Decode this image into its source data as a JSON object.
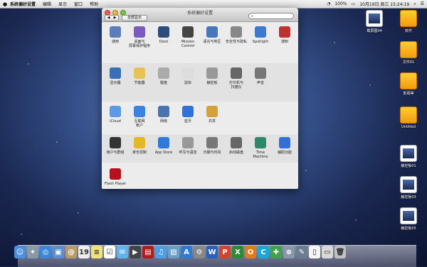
{
  "menubar": {
    "apple": "",
    "items": [
      "系统偏好设置",
      "编辑",
      "显示",
      "窗口",
      "帮助"
    ],
    "status": {
      "battery": "100%",
      "datetime": "10月19日 周三  15:24:19"
    }
  },
  "window": {
    "title": "系统偏好设置",
    "nav_back": "◀",
    "nav_forward": "▶",
    "show_all": "全部显示",
    "search_placeholder": ""
  },
  "panes": [
    {
      "label": "通用",
      "icon": "general-icon",
      "color": "#5a7fb8"
    },
    {
      "label": "桌面与\n屏幕保护程序",
      "icon": "desktop-icon",
      "color": "#7b5bbd"
    },
    {
      "label": "Dock",
      "icon": "dock-icon",
      "color": "#2c4c7c"
    },
    {
      "label": "Mission\nControl",
      "icon": "mission-control-icon",
      "color": "#444"
    },
    {
      "label": "语言与地区",
      "icon": "language-icon",
      "color": "#4477bb"
    },
    {
      "label": "安全性与隐私",
      "icon": "security-icon",
      "color": "#888"
    },
    {
      "label": "Spotlight",
      "icon": "spotlight-icon",
      "color": "#3b79d6"
    },
    {
      "label": "通知",
      "icon": "notifications-icon",
      "color": "#c03030"
    },
    {
      "label": "显示器",
      "icon": "display-icon",
      "color": "#3a6fb6"
    },
    {
      "label": "节能器",
      "icon": "energy-saver-icon",
      "color": "#e6c35a"
    },
    {
      "label": "键盘",
      "icon": "keyboard-icon",
      "color": "#aaa"
    },
    {
      "label": "鼠标",
      "icon": "mouse-icon",
      "color": "#ddd"
    },
    {
      "label": "触控板",
      "icon": "trackpad-icon",
      "color": "#999"
    },
    {
      "label": "打印机与\n扫描仪",
      "icon": "printer-icon",
      "color": "#666"
    },
    {
      "label": "声音",
      "icon": "sound-icon",
      "color": "#777"
    },
    {
      "label": "iCloud",
      "icon": "icloud-icon",
      "color": "#5b9be6"
    },
    {
      "label": "互联网\n帐户",
      "icon": "internet-accounts-icon",
      "color": "#3c82e0"
    },
    {
      "label": "网络",
      "icon": "network-icon",
      "color": "#4a74b0"
    },
    {
      "label": "蓝牙",
      "icon": "bluetooth-icon",
      "color": "#2f72d8"
    },
    {
      "label": "共享",
      "icon": "sharing-icon",
      "color": "#d4a13c"
    },
    {
      "label": "用户与群组",
      "icon": "users-groups-icon",
      "color": "#333"
    },
    {
      "label": "家长控制",
      "icon": "parental-controls-icon",
      "color": "#e3b823"
    },
    {
      "label": "App Store",
      "icon": "app-store-icon",
      "color": "#2f7ad9"
    },
    {
      "label": "听写与语音",
      "icon": "dictation-icon",
      "color": "#999"
    },
    {
      "label": "日期与时间",
      "icon": "date-time-icon",
      "color": "#777"
    },
    {
      "label": "启动磁盘",
      "icon": "startup-disk-icon",
      "color": "#666"
    },
    {
      "label": "Time Machine",
      "icon": "time-machine-icon",
      "color": "#2c8a6a"
    },
    {
      "label": "辅助功能",
      "icon": "accessibility-icon",
      "color": "#2f6fd6"
    },
    {
      "label": "Flash Player",
      "icon": "flash-player-icon",
      "color": "#b3121e"
    }
  ],
  "desktop": [
    {
      "label": "截屏图04",
      "icon": "screenshot-icon"
    },
    {
      "label": "软件",
      "icon": "drive-icon"
    },
    {
      "label": "文件01",
      "icon": "drive-icon"
    },
    {
      "label": "影视等",
      "icon": "drive-icon"
    },
    {
      "label": "Untitled",
      "icon": "drive-icon"
    },
    {
      "label": "触控板01",
      "icon": "screenshot-icon"
    },
    {
      "label": "触控板03",
      "icon": "screenshot-icon"
    },
    {
      "label": "触控板05",
      "icon": "screenshot-icon"
    }
  ],
  "dock": [
    {
      "name": "finder-icon",
      "color": "#4a8fe0",
      "glyph": "☺"
    },
    {
      "name": "launchpad-icon",
      "color": "#8899aa",
      "glyph": "✦"
    },
    {
      "name": "safari-icon",
      "color": "#3b86d8",
      "glyph": "◎"
    },
    {
      "name": "preview-icon",
      "color": "#5b8fd0",
      "glyph": "▣"
    },
    {
      "name": "contacts-icon",
      "color": "#b89a6b",
      "glyph": "@"
    },
    {
      "name": "calendar-icon",
      "color": "#eeeeee",
      "glyph": "19"
    },
    {
      "name": "notes-icon",
      "color": "#f2e27a",
      "glyph": "≡"
    },
    {
      "name": "reminders-icon",
      "color": "#ffffff",
      "glyph": "☑"
    },
    {
      "name": "messages-icon",
      "color": "#5fb3ef",
      "glyph": "✉"
    },
    {
      "name": "facetime-icon",
      "color": "#444444",
      "glyph": "▶"
    },
    {
      "name": "photo-booth-icon",
      "color": "#b11d1d",
      "glyph": "▤"
    },
    {
      "name": "itunes-icon",
      "color": "#4c9ee8",
      "glyph": "♫"
    },
    {
      "name": "iphoto-icon",
      "color": "#6aa0c8",
      "glyph": "▨"
    },
    {
      "name": "app-store-dock-icon",
      "color": "#2e7ad4",
      "glyph": "A"
    },
    {
      "name": "system-preferences-icon",
      "color": "#888888",
      "glyph": "⚙"
    },
    {
      "name": "word-icon",
      "color": "#2b61b8",
      "glyph": "W"
    },
    {
      "name": "powerpoint-icon",
      "color": "#d2452a",
      "glyph": "P"
    },
    {
      "name": "excel-icon",
      "color": "#2d8a3a",
      "glyph": "X"
    },
    {
      "name": "outlook-icon",
      "color": "#e07a1a",
      "glyph": "O"
    },
    {
      "name": "communicator-icon",
      "color": "#1aa6d6",
      "glyph": "C"
    },
    {
      "name": "messenger-icon",
      "color": "#3fa34d",
      "glyph": "✚"
    },
    {
      "name": "network-utility-icon",
      "color": "#8899aa",
      "glyph": "⊕"
    },
    {
      "name": "utility-icon",
      "color": "#6a7c90",
      "glyph": "✎"
    },
    {
      "name": "document-icon",
      "color": "#f4f4f4",
      "glyph": "▯"
    },
    {
      "name": "downloads-icon",
      "color": "#d8d8d8",
      "glyph": "▭"
    },
    {
      "name": "trash-icon",
      "color": "#c0c0c0",
      "glyph": "🗑"
    }
  ]
}
